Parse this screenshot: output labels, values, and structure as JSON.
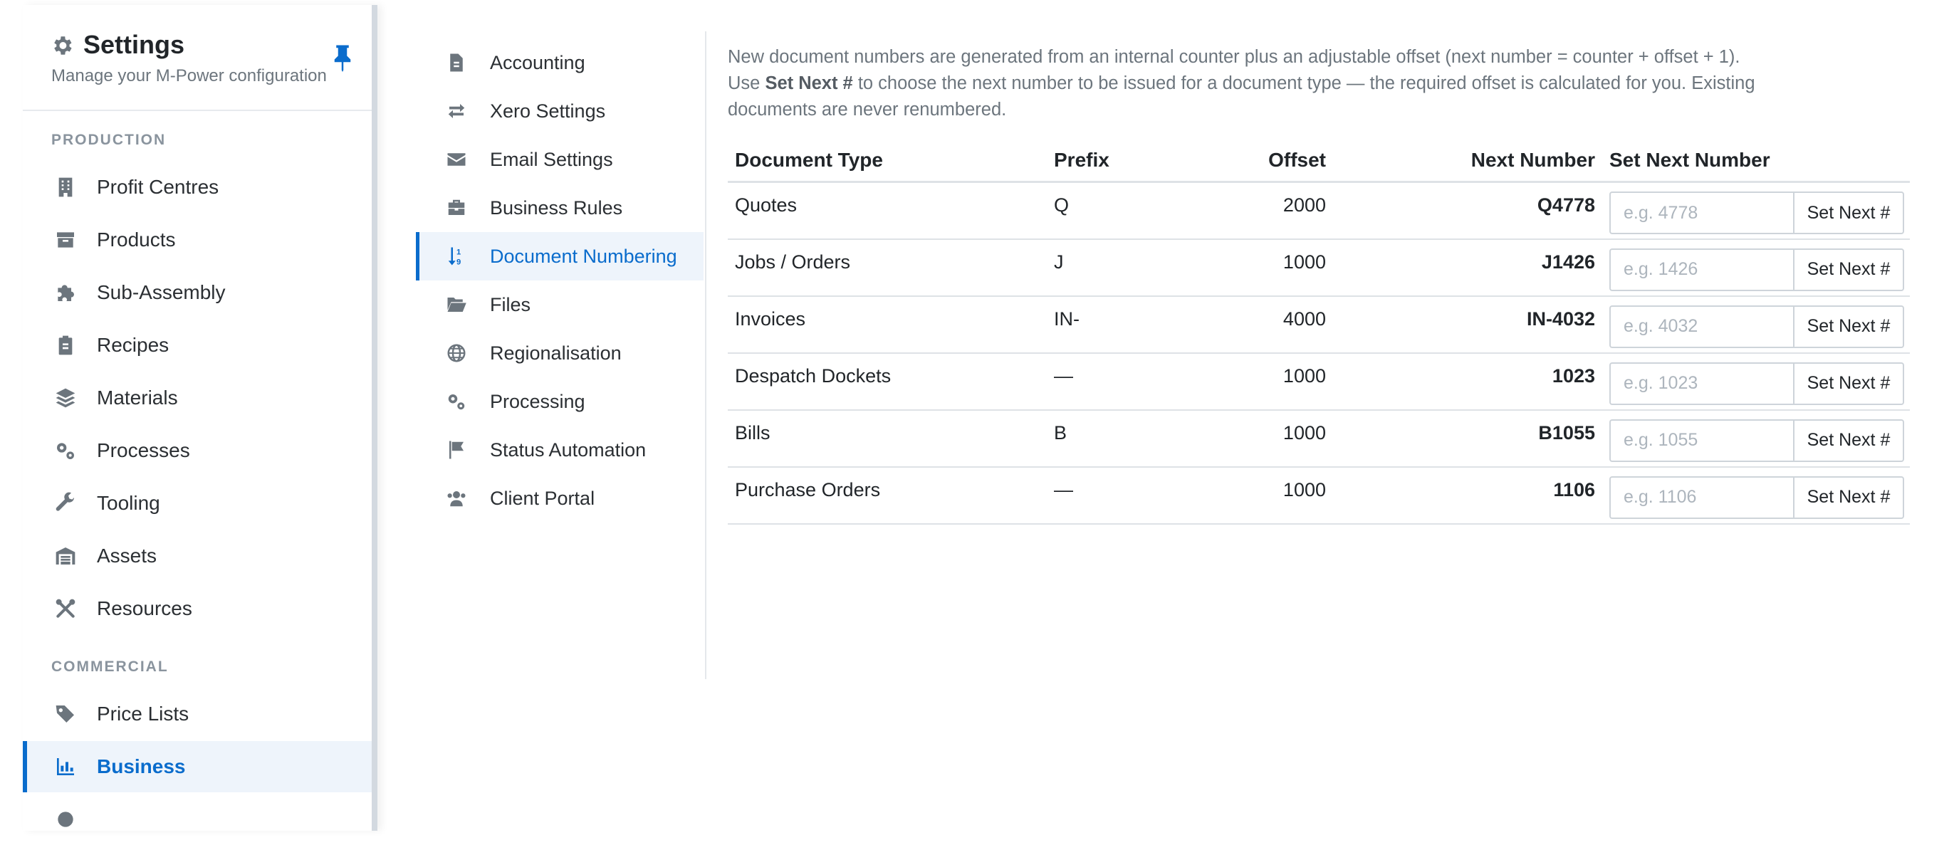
{
  "sidebar": {
    "title": "Settings",
    "subtitle": "Manage your M-Power configuration",
    "sections": [
      {
        "label": "PRODUCTION",
        "items": [
          {
            "label": "Profit Centres",
            "icon": "building-icon"
          },
          {
            "label": "Products",
            "icon": "box-icon"
          },
          {
            "label": "Sub-Assembly",
            "icon": "puzzle-icon"
          },
          {
            "label": "Recipes",
            "icon": "clipboard-icon"
          },
          {
            "label": "Materials",
            "icon": "layers-icon"
          },
          {
            "label": "Processes",
            "icon": "cogs-icon"
          },
          {
            "label": "Tooling",
            "icon": "wrench-icon"
          },
          {
            "label": "Assets",
            "icon": "warehouse-icon"
          },
          {
            "label": "Resources",
            "icon": "tools-icon"
          }
        ]
      },
      {
        "label": "COMMERCIAL",
        "items": [
          {
            "label": "Price Lists",
            "icon": "tags-icon"
          },
          {
            "label": "Business",
            "icon": "chart-icon",
            "active": true
          }
        ]
      }
    ]
  },
  "subnav": {
    "items": [
      {
        "label": "Accounting",
        "icon": "file-icon"
      },
      {
        "label": "Xero Settings",
        "icon": "exchange-icon"
      },
      {
        "label": "Email Settings",
        "icon": "envelope-icon"
      },
      {
        "label": "Business Rules",
        "icon": "briefcase-icon"
      },
      {
        "label": "Document Numbering",
        "icon": "sort-numeric-icon",
        "active": true
      },
      {
        "label": "Files",
        "icon": "folder-open-icon"
      },
      {
        "label": "Regionalisation",
        "icon": "globe-icon"
      },
      {
        "label": "Processing",
        "icon": "cogs-icon"
      },
      {
        "label": "Status Automation",
        "icon": "flag-icon"
      },
      {
        "label": "Client Portal",
        "icon": "users-icon"
      }
    ]
  },
  "main": {
    "intro": {
      "text_a": "New document numbers are generated from an internal counter plus an adjustable offset (next number = counter + offset + 1). Use ",
      "bold": "Set Next #",
      "text_b": " to choose the next number to be issued for a document type — the required offset is calculated for you. Existing documents are never renumbered."
    },
    "table": {
      "headers": {
        "document_type": "Document Type",
        "prefix": "Prefix",
        "offset": "Offset",
        "next_number": "Next Number",
        "set_next_number": "Set Next Number"
      },
      "button_label": "Set Next #",
      "rows": [
        {
          "document_type": "Quotes",
          "prefix": "Q",
          "offset": "2000",
          "next_number": "Q4778",
          "placeholder": "e.g. 4778"
        },
        {
          "document_type": "Jobs / Orders",
          "prefix": "J",
          "offset": "1000",
          "next_number": "J1426",
          "placeholder": "e.g. 1426"
        },
        {
          "document_type": "Invoices",
          "prefix": "IN-",
          "offset": "4000",
          "next_number": "IN-4032",
          "placeholder": "e.g. 4032"
        },
        {
          "document_type": "Despatch Dockets",
          "prefix": "—",
          "offset": "1000",
          "next_number": "1023",
          "placeholder": "e.g. 1023"
        },
        {
          "document_type": "Bills",
          "prefix": "B",
          "offset": "1000",
          "next_number": "B1055",
          "placeholder": "e.g. 1055"
        },
        {
          "document_type": "Purchase Orders",
          "prefix": "—",
          "offset": "1000",
          "next_number": "1106",
          "placeholder": "e.g. 1106"
        }
      ]
    }
  },
  "colors": {
    "accent": "#0a6ccc",
    "icon_gray": "#6c757d",
    "active_bg": "#eef4fb"
  }
}
